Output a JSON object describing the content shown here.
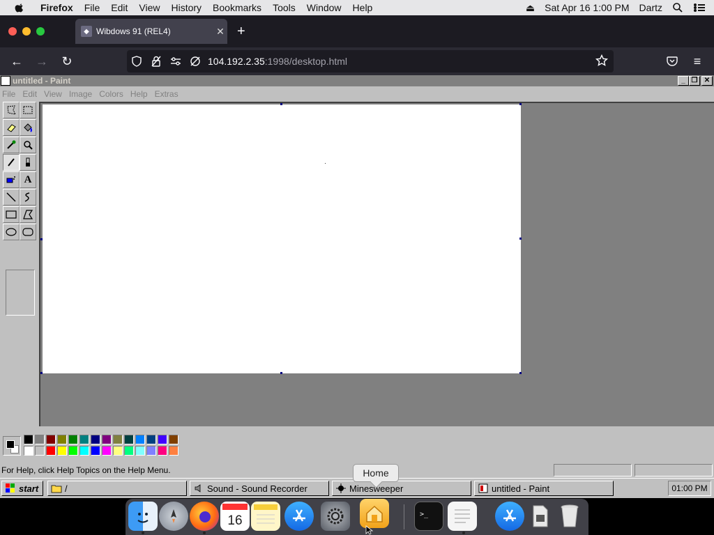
{
  "mac_menubar": {
    "app": "Firefox",
    "items": [
      "File",
      "Edit",
      "View",
      "History",
      "Bookmarks",
      "Tools",
      "Window",
      "Help"
    ],
    "date_time": "Sat Apr 16  1:00 PM",
    "user": "Dartz"
  },
  "browser": {
    "tab_title": "Wibdows 91 (REL4)",
    "url_host": "104.192.2.35",
    "url_path": ":1998/desktop.html"
  },
  "paint": {
    "title": "untitled - Paint",
    "menu": [
      "File",
      "Edit",
      "View",
      "Image",
      "Colors",
      "Help",
      "Extras"
    ],
    "status_message": "For Help, click Help Topics on the Help Menu.",
    "palette_top": [
      "#000000",
      "#808080",
      "#800000",
      "#808000",
      "#008000",
      "#008080",
      "#000080",
      "#800080",
      "#808040",
      "#004040",
      "#0080ff",
      "#004080",
      "#4000ff",
      "#804000"
    ],
    "palette_bottom": [
      "#ffffff",
      "#c0c0c0",
      "#ff0000",
      "#ffff00",
      "#00ff00",
      "#00ffff",
      "#0000ff",
      "#ff00ff",
      "#ffff80",
      "#00ff80",
      "#80ffff",
      "#8080ff",
      "#ff0080",
      "#ff8040"
    ],
    "foreground_color": "#000000",
    "background_color": "#ffffff"
  },
  "taskbar": {
    "start_label": "start",
    "items": [
      {
        "label": "/"
      },
      {
        "label": "Sound - Sound Recorder"
      },
      {
        "label": "Minesweeper"
      },
      {
        "label": "untitled - Paint"
      }
    ],
    "clock": "01:00 PM"
  },
  "tooltip": {
    "label": "Home"
  }
}
